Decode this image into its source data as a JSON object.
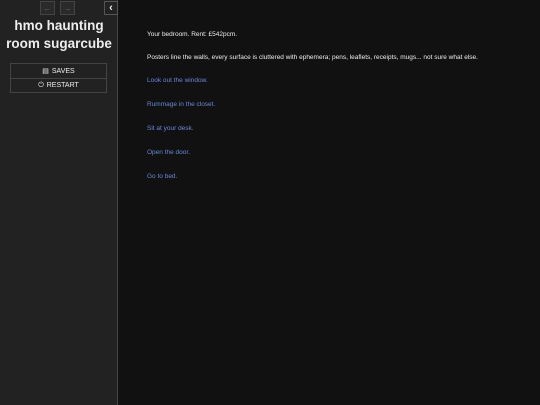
{
  "sidebar": {
    "title": "hmo haunting room sugarcube",
    "history_back": "←",
    "history_forward": "→",
    "toggle": "‹",
    "menu": [
      {
        "label": "SAVES",
        "icon": "floppy-disk-icon",
        "glyph": "▤"
      },
      {
        "label": "RESTART",
        "icon": "power-icon",
        "glyph": "⏻"
      }
    ]
  },
  "passage": {
    "line1": "Your bedroom. Rent: £542pcm.",
    "line2": "Posters line the walls, every surface is cluttered with ephemera; pens, leaflets, receipts, mugs... not sure what else.",
    "links": [
      "Look out the window.",
      "Rummage in the closet.",
      "Sit at your desk.",
      "Open the door.",
      "Go to bed."
    ]
  },
  "colors": {
    "background": "#111111",
    "sidebar": "#222222",
    "link": "#6688dd",
    "text": "#eeeeee"
  }
}
